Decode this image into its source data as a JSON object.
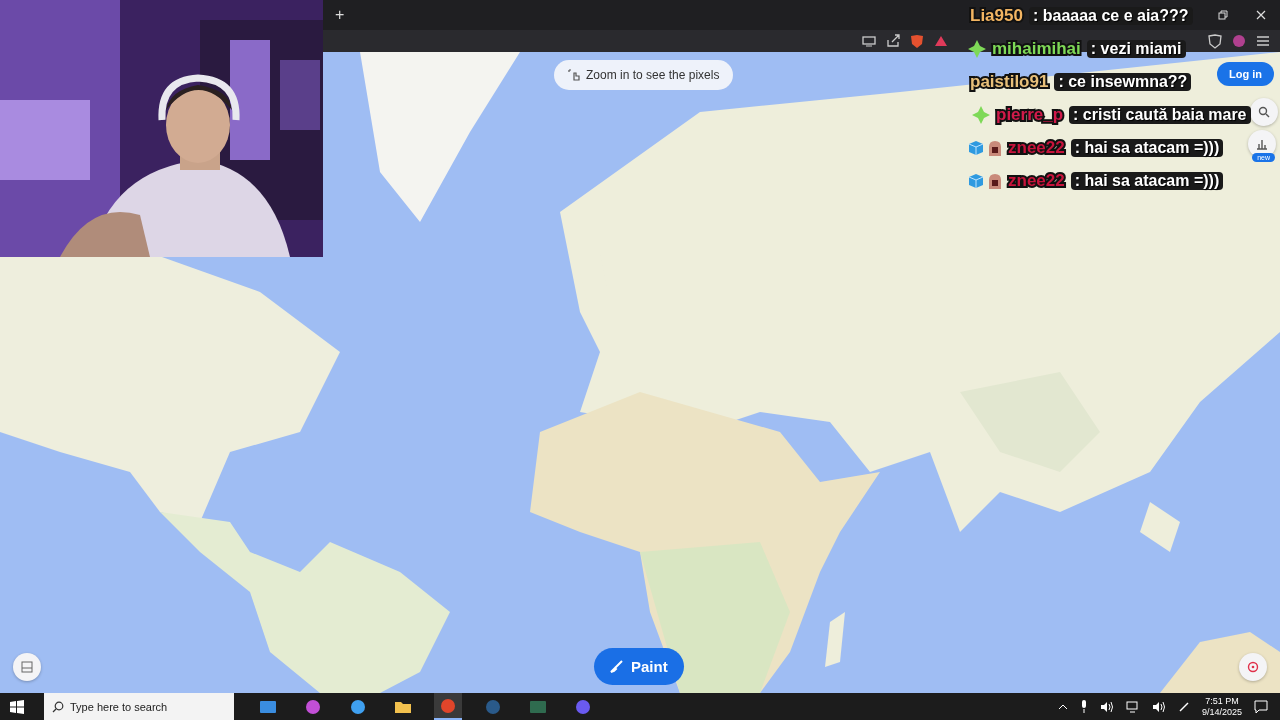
{
  "browser": {
    "new_tab_button": "+"
  },
  "map": {
    "zoom_hint": "Zoom in to see the pixels",
    "login_button": "Log in",
    "new_badge": "new",
    "paint_button": "Paint"
  },
  "chat": [
    {
      "kind": "plain",
      "user": "Lia950",
      "message": ": baaaaa ce e aia???",
      "color": "#f3b562"
    },
    {
      "kind": "gem",
      "user": "mihaimihai",
      "message": ": vezi miami",
      "color": "#7ed957"
    },
    {
      "kind": "plain",
      "user": "paistilo91",
      "message": ": ce insewmna??",
      "color": "#e8c07a"
    },
    {
      "kind": "gem",
      "user": "pierre_p",
      "message": ": cristi caută baia mare",
      "color": "#d11a4a"
    },
    {
      "kind": "cube",
      "user": "znee22",
      "message": ": hai sa atacam =)))",
      "color": "#c8143c"
    },
    {
      "kind": "cube",
      "user": "znee22",
      "message": ": hai sa atacam =)))",
      "color": "#c8143c"
    }
  ],
  "taskbar": {
    "search_placeholder": "Type here to search",
    "apps": [
      {
        "kind": "window",
        "selected": false
      },
      {
        "kind": "m365",
        "selected": false
      },
      {
        "kind": "copilot",
        "selected": false
      },
      {
        "kind": "folder",
        "selected": false
      },
      {
        "kind": "brave",
        "selected": true
      },
      {
        "kind": "steam",
        "selected": false
      },
      {
        "kind": "terminal",
        "selected": false
      },
      {
        "kind": "discord",
        "selected": false
      }
    ],
    "time": "7:51 PM",
    "date": "9/14/2025"
  }
}
